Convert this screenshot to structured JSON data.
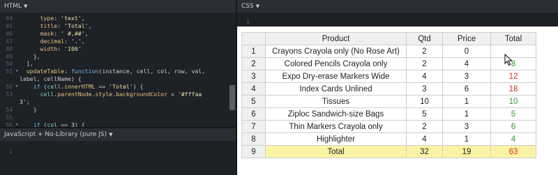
{
  "panels": {
    "html_label": "HTML",
    "css_label": "CSS",
    "js_label": "JavaScript + No-Library (pure JS)"
  },
  "code": {
    "lines": [
      {
        "n": "44",
        "fold": false,
        "parts": [
          [
            "p",
            "      "
          ],
          [
            "k",
            "type"
          ],
          [
            "p",
            ": "
          ],
          [
            "s",
            "'text'"
          ],
          [
            "p",
            ","
          ]
        ]
      },
      {
        "n": "45",
        "fold": false,
        "parts": [
          [
            "p",
            "      "
          ],
          [
            "k",
            "title"
          ],
          [
            "p",
            ": "
          ],
          [
            "s",
            "'Total'"
          ],
          [
            "p",
            ","
          ]
        ]
      },
      {
        "n": "46",
        "fold": false,
        "parts": [
          [
            "p",
            "      "
          ],
          [
            "k",
            "mask"
          ],
          [
            "p",
            ": "
          ],
          [
            "s",
            "' #,##'"
          ],
          [
            "p",
            ","
          ]
        ]
      },
      {
        "n": "47",
        "fold": false,
        "parts": [
          [
            "p",
            "      "
          ],
          [
            "k",
            "decimal"
          ],
          [
            "p",
            ": "
          ],
          [
            "s",
            "'.'"
          ],
          [
            "p",
            ","
          ]
        ]
      },
      {
        "n": "48",
        "fold": false,
        "parts": [
          [
            "p",
            "      "
          ],
          [
            "k",
            "width"
          ],
          [
            "p",
            ": "
          ],
          [
            "s",
            "'100'"
          ]
        ]
      },
      {
        "n": "49",
        "fold": false,
        "parts": [
          [
            "p",
            "    },"
          ]
        ]
      },
      {
        "n": "50",
        "fold": false,
        "parts": [
          [
            "p",
            "  ],"
          ]
        ]
      },
      {
        "n": "51",
        "fold": true,
        "parts": [
          [
            "p",
            "  "
          ],
          [
            "k",
            "updateTable"
          ],
          [
            "p",
            ": "
          ],
          [
            "kw",
            "function"
          ],
          [
            "p",
            "(instance, cell, col, row, val,"
          ]
        ]
      },
      {
        "n": "",
        "fold": false,
        "parts": [
          [
            "p",
            "label, cellName) {"
          ]
        ]
      },
      {
        "n": "52",
        "fold": true,
        "parts": [
          [
            "p",
            "    "
          ],
          [
            "kw",
            "if"
          ],
          [
            "p",
            " ("
          ],
          [
            "fn",
            "cell"
          ],
          [
            "p",
            "."
          ],
          [
            "k",
            "innerHTML"
          ],
          [
            "p",
            " == "
          ],
          [
            "s",
            "'Total'"
          ],
          [
            "p",
            ") {"
          ]
        ]
      },
      {
        "n": "53",
        "fold": false,
        "parts": [
          [
            "p",
            "      "
          ],
          [
            "fn",
            "cell"
          ],
          [
            "p",
            "."
          ],
          [
            "k",
            "parentNode"
          ],
          [
            "p",
            "."
          ],
          [
            "k",
            "style"
          ],
          [
            "p",
            "."
          ],
          [
            "k",
            "backgroundColor"
          ],
          [
            "p",
            " = "
          ],
          [
            "s",
            "'#fffaa"
          ]
        ]
      },
      {
        "n": "",
        "fold": false,
        "parts": [
          [
            "s",
            "3'"
          ],
          [
            "p",
            ";"
          ]
        ]
      },
      {
        "n": "54",
        "fold": false,
        "parts": [
          [
            "p",
            "    }"
          ]
        ]
      },
      {
        "n": "55",
        "fold": false,
        "parts": [
          [
            "p",
            ""
          ]
        ]
      },
      {
        "n": "56",
        "fold": true,
        "parts": [
          [
            "p",
            "    "
          ],
          [
            "kw",
            "if"
          ],
          [
            "p",
            " ("
          ],
          [
            "fn",
            "col"
          ],
          [
            "p",
            " == "
          ],
          [
            "v",
            "3"
          ],
          [
            "p",
            ") {"
          ]
        ]
      }
    ]
  },
  "js_line_number": "1",
  "css_line_number": "1",
  "table": {
    "columns": [
      "Product",
      "Qtd",
      "Price",
      "Total"
    ],
    "rows": [
      {
        "num": "1",
        "product": "Crayons Crayola only (No Rose Art)",
        "qtd": "2",
        "price": "0",
        "total": "",
        "total_color": "pos"
      },
      {
        "num": "2",
        "product": "Colored Pencils Crayola only",
        "qtd": "2",
        "price": "4",
        "total": "8",
        "total_color": "pos"
      },
      {
        "num": "3",
        "product": "Expo Dry-erase Markers Wide",
        "qtd": "4",
        "price": "3",
        "total": "12",
        "total_color": "neg"
      },
      {
        "num": "4",
        "product": "Index Cards Unlined",
        "qtd": "3",
        "price": "6",
        "total": "18",
        "total_color": "neg"
      },
      {
        "num": "5",
        "product": "Tissues",
        "qtd": "10",
        "price": "1",
        "total": "10",
        "total_color": "pos"
      },
      {
        "num": "6",
        "product": "Ziploc Sandwich-size Bags",
        "qtd": "5",
        "price": "1",
        "total": "5",
        "total_color": "pos"
      },
      {
        "num": "7",
        "product": "Thin Markers Crayola only",
        "qtd": "2",
        "price": "3",
        "total": "6",
        "total_color": "pos"
      },
      {
        "num": "8",
        "product": "Highlighter",
        "qtd": "4",
        "price": "1",
        "total": "4",
        "total_color": "pos"
      },
      {
        "num": "9",
        "product": "Total",
        "qtd": "32",
        "price": "19",
        "total": "63",
        "total_color": "neg",
        "is_total": true
      }
    ]
  },
  "colors": {
    "positive": "#2e9b2e",
    "negative": "#e0281f",
    "total_row_bg": "#fbf3a4"
  }
}
